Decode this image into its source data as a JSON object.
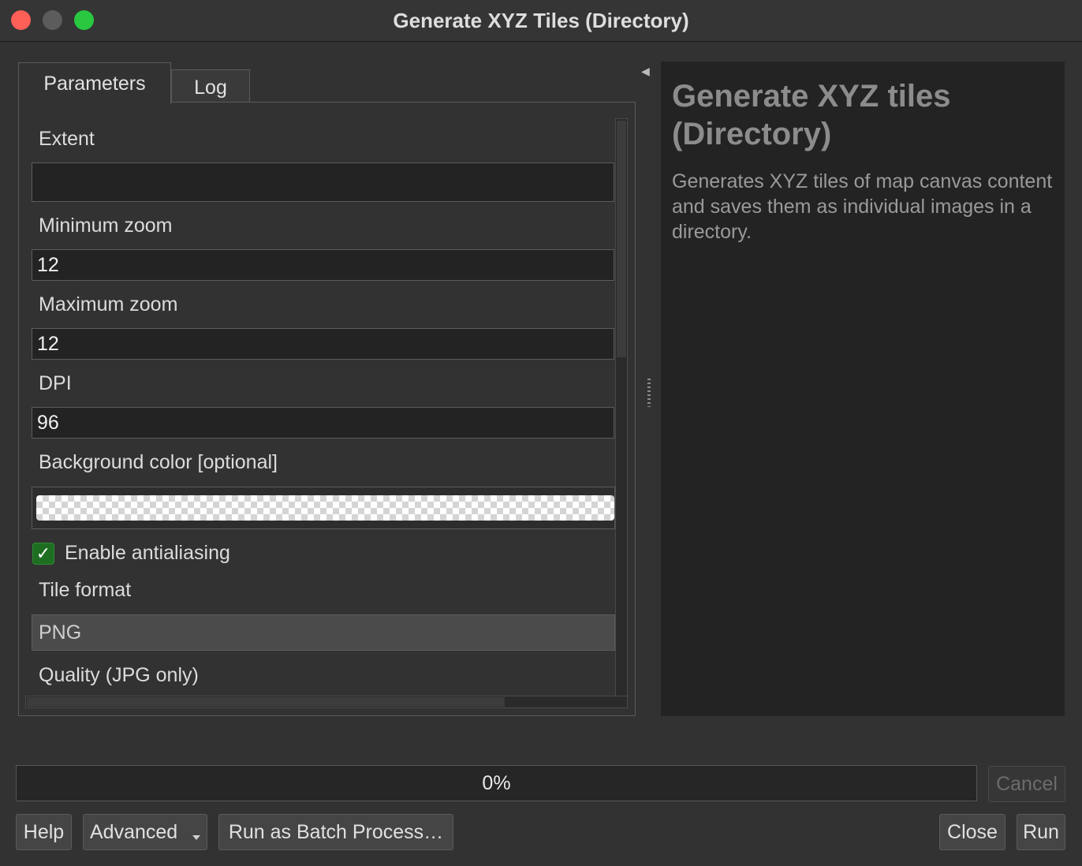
{
  "window": {
    "title": "Generate XYZ Tiles (Directory)"
  },
  "tabs": {
    "parameters": "Parameters",
    "log": "Log"
  },
  "params": {
    "extent": {
      "label": "Extent",
      "value": ""
    },
    "min_zoom": {
      "label": "Minimum zoom",
      "value": "12"
    },
    "max_zoom": {
      "label": "Maximum zoom",
      "value": "12"
    },
    "dpi": {
      "label": "DPI",
      "value": "96"
    },
    "bg_color": {
      "label": "Background color [optional]"
    },
    "antialias": {
      "label": "Enable antialiasing",
      "checked": true
    },
    "tile_format": {
      "label": "Tile format",
      "value": "PNG"
    },
    "quality": {
      "label": "Quality (JPG only)"
    }
  },
  "help": {
    "title": "Generate XYZ tiles (Directory)",
    "description": "Generates XYZ tiles of map canvas content and saves them as individual images in a directory."
  },
  "progress": {
    "text": "0%",
    "fraction": 0
  },
  "buttons": {
    "cancel": "Cancel",
    "help": "Help",
    "advanced": "Advanced",
    "batch": "Run as Batch Process…",
    "close": "Close",
    "run": "Run"
  },
  "icons": {
    "checkmark": "checkmark-icon",
    "dropdown": "chevron-down-icon",
    "collapse": "collapse-left-icon"
  }
}
